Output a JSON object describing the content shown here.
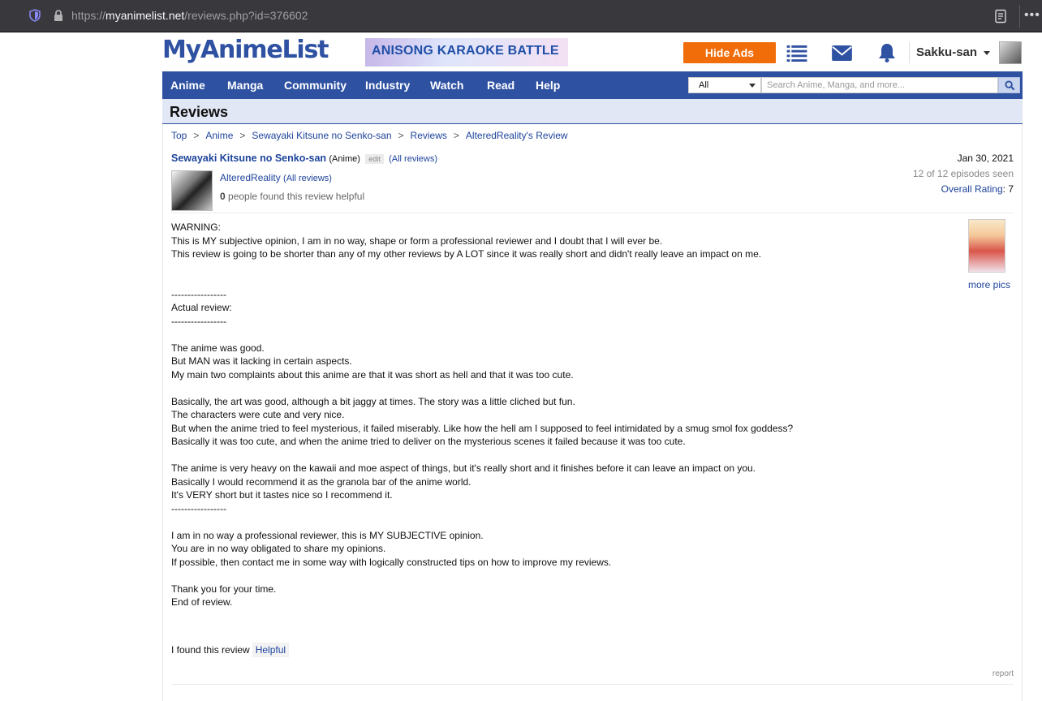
{
  "browser": {
    "url_prefix": "https://",
    "url_host": "myanimelist.net",
    "url_path": "/reviews.php?id=376602"
  },
  "header": {
    "logo": "MyAnimeList",
    "ad_text": "ANISONG KARAOKE BATTLE",
    "hide_ads": "Hide Ads",
    "username": "Sakku-san"
  },
  "nav": {
    "items": [
      "Anime",
      "Manga",
      "Community",
      "Industry",
      "Watch",
      "Read",
      "Help"
    ],
    "search_scope": "All",
    "search_placeholder": "Search Anime, Manga, and more..."
  },
  "page": {
    "title": "Reviews",
    "breadcrumb": [
      "Top",
      "Anime",
      "Sewayaki Kitsune no Senko-san",
      "Reviews",
      "AlteredReality's Review"
    ]
  },
  "review": {
    "anime_title": "Sewayaki Kitsune no Senko-san",
    "media_type": "(Anime)",
    "edit": "edit",
    "all_reviews_link": "(All reviews)",
    "reviewer": "AlteredReality",
    "reviewer_all_reviews": "(All reviews)",
    "helpful_count": "0",
    "helpful_text": "people found this review helpful",
    "date": "Jan 30, 2021",
    "episodes": "12 of 12 episodes seen",
    "overall_rating_label": "Overall Rating",
    "overall_rating_value": "7",
    "more_pics": "more pics",
    "body": "WARNING:\nThis is MY subjective opinion, I am in no way, shape or form a professional reviewer and I doubt that I will ever be.\nThis review is going to be shorter than any of my other reviews by A LOT since it was really short and didn't really leave an impact on me.\n\n\n-----------------\nActual review:\n-----------------\n\nThe anime was good.\nBut MAN was it lacking in certain aspects.\nMy main two complaints about this anime are that it was short as hell and that it was too cute.\n\nBasically, the art was good, although a bit jaggy at times. The story was a little cliched but fun.\nThe characters were cute and very nice.\nBut when the anime tried to feel mysterious, it failed miserably. Like how the hell am I supposed to feel intimidated by a smug smol fox goddess?\nBasically it was too cute, and when the anime tried to deliver on the mysterious scenes it failed because it was too cute.\n\nThe anime is very heavy on the kawaii and moe aspect of things, but it's really short and it finishes before it can leave an impact on you.\nBasically I would recommend it as the granola bar of the anime world.\nIt's VERY short but it tastes nice so I recommend it.\n-----------------\n\nI am in no way a professional reviewer, this is MY SUBJECTIVE opinion.\nYou are in no way obligated to share my opinions.\nIf possible, then contact me in some way with logically constructed tips on how to improve my reviews.\n\nThank you for your time.\nEnd of review.",
    "found_prefix": "I found this review",
    "helpful_button": "Helpful",
    "report": "report"
  },
  "colors": {
    "brand_blue": "#2e51a2",
    "link_blue": "#1d439b",
    "hide_ads_orange": "#f06d0a"
  },
  "icons": [
    "shield-icon",
    "lock-icon",
    "reader-view-icon",
    "list-icon",
    "mail-icon",
    "bell-icon",
    "search-icon",
    "caret-down-icon"
  ]
}
